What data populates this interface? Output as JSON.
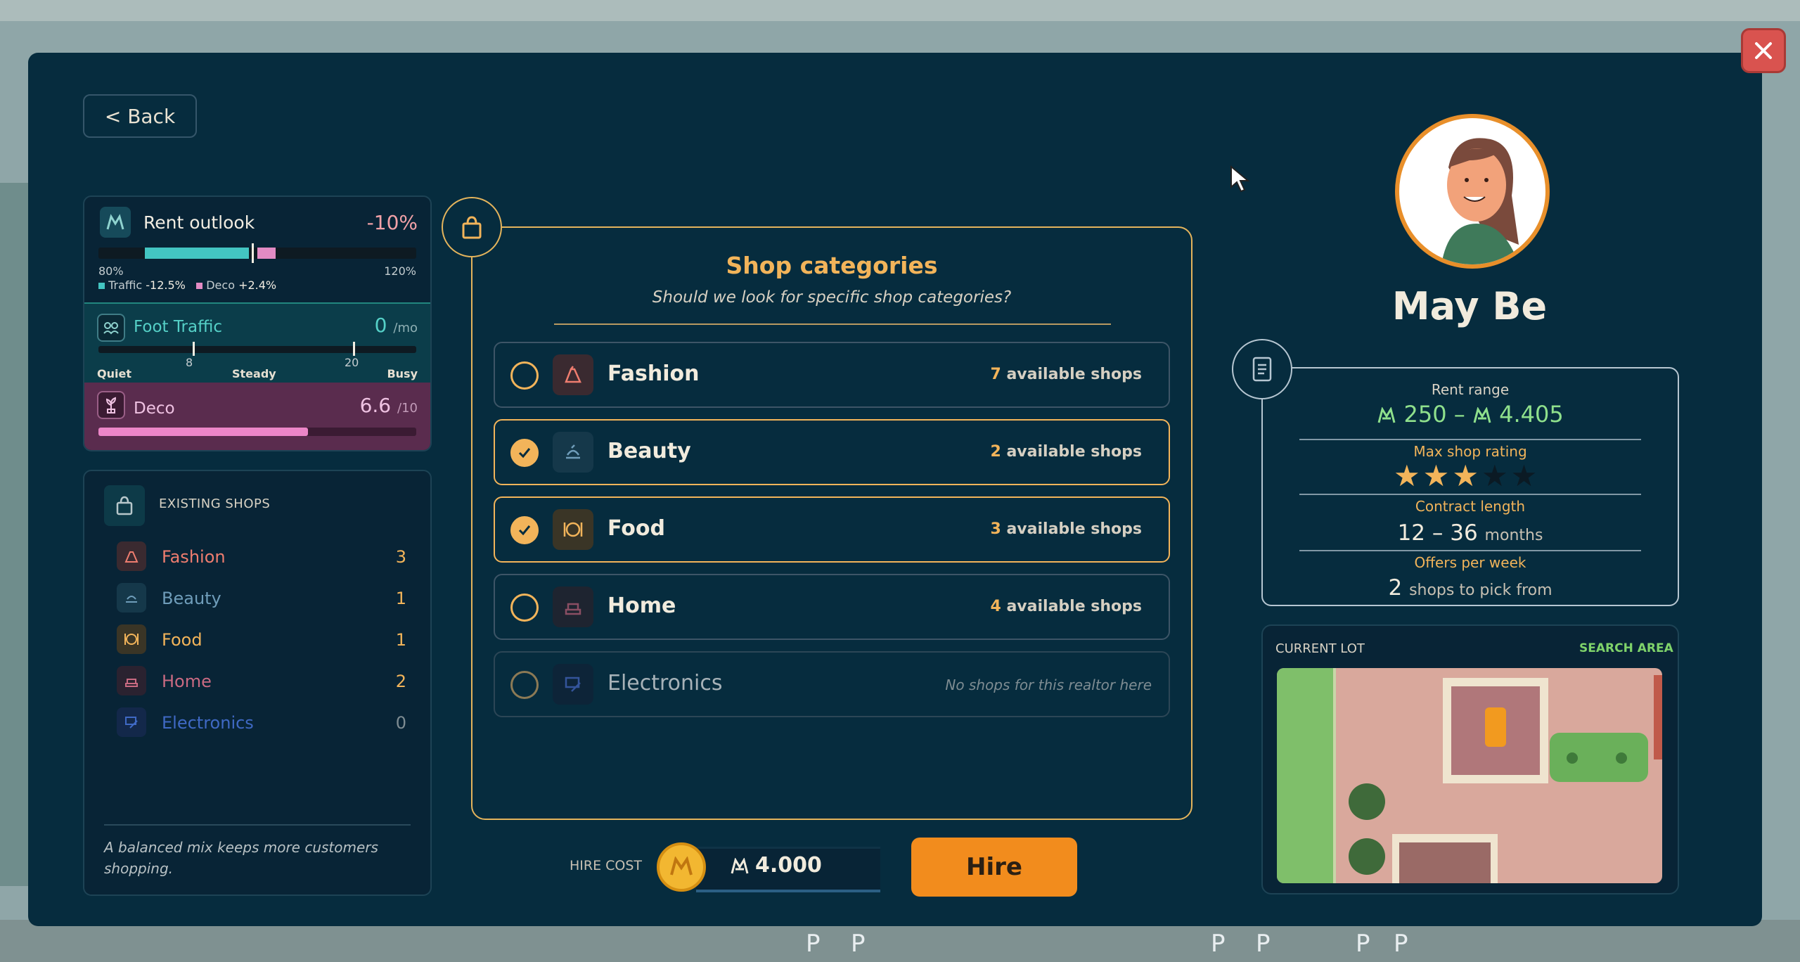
{
  "back_label": "< Back",
  "rent_outlook": {
    "title": "Rent outlook",
    "change": "-10%",
    "min_label": "80%",
    "max_label": "120%",
    "traffic_label": "Traffic",
    "traffic_value": "-12.5%",
    "deco_label": "Deco",
    "deco_value": "+2.4%"
  },
  "foot_traffic": {
    "title": "Foot Traffic",
    "value": "0",
    "unit": "/mo",
    "tick_low": "8",
    "tick_high": "20",
    "labels": [
      "Quiet",
      "Steady",
      "Busy"
    ]
  },
  "deco": {
    "title": "Deco",
    "value": "6.6",
    "unit": "/10",
    "fill_fraction": 0.66
  },
  "existing_shops": {
    "header": "EXISTING SHOPS",
    "items": [
      {
        "name": "Fashion",
        "count": "3"
      },
      {
        "name": "Beauty",
        "count": "1"
      },
      {
        "name": "Food",
        "count": "1"
      },
      {
        "name": "Home",
        "count": "2"
      },
      {
        "name": "Electronics",
        "count": "0"
      }
    ],
    "tip": "A balanced mix keeps more customers shopping."
  },
  "categories": {
    "title": "Shop categories",
    "subtitle": "Should we look for specific shop categories?",
    "suffix": "available shops",
    "items": [
      {
        "name": "Fashion",
        "count": "7",
        "selected": false
      },
      {
        "name": "Beauty",
        "count": "2",
        "selected": true
      },
      {
        "name": "Food",
        "count": "3",
        "selected": true
      },
      {
        "name": "Home",
        "count": "4",
        "selected": false
      },
      {
        "name": "Electronics",
        "count": "",
        "selected": false,
        "none_text": "No shops for this realtor here"
      }
    ]
  },
  "hire": {
    "label": "HIRE COST",
    "cost": "4.000",
    "button": "Hire"
  },
  "realtor": {
    "name": "May Be",
    "rent_range_label": "Rent range",
    "rent_min": "250",
    "rent_max": "4.405",
    "max_rating_label": "Max shop rating",
    "rating": 3,
    "rating_max": 5,
    "contract_label": "Contract length",
    "contract_min": "12",
    "contract_max": "36",
    "contract_unit": "months",
    "offers_label": "Offers per week",
    "offers_value": "2",
    "offers_unit": "shops to pick from"
  },
  "lot": {
    "title": "CURRENT LOT",
    "search": "SEARCH AREA"
  },
  "background": {
    "parking_label": "P"
  },
  "colors": {
    "panel": "#062c3e",
    "accent": "#f2b45a",
    "hire_button": "#f28c1d",
    "fashion": "#ef7d6f",
    "beauty": "#6f9dba",
    "food": "#f2b45a",
    "home": "#c96a82",
    "electronics": "#3f69c4"
  }
}
